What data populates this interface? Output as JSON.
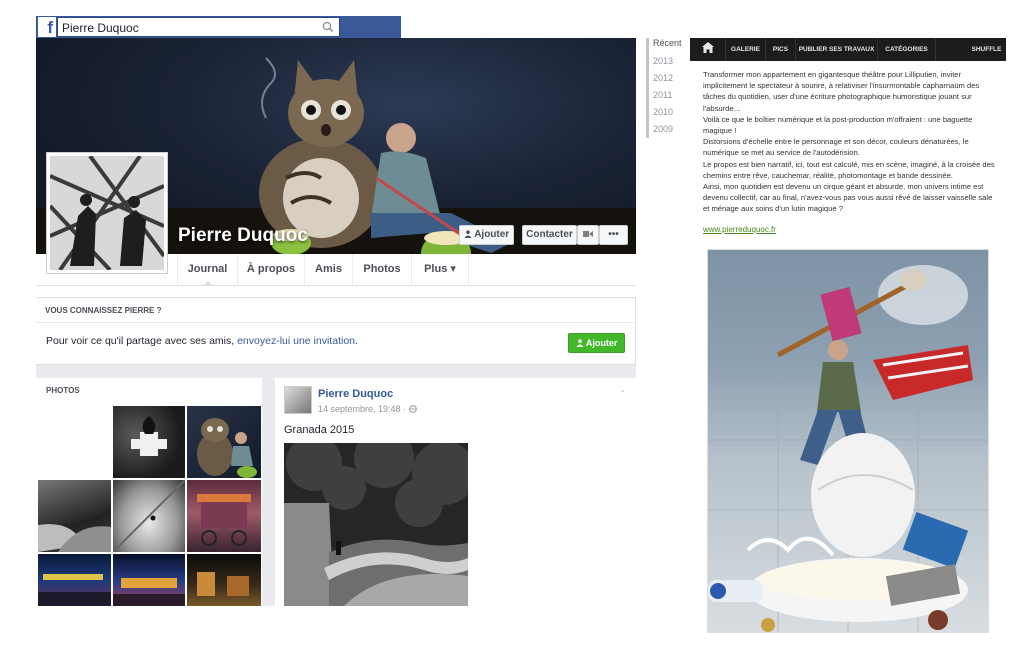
{
  "facebook": {
    "logo": "f",
    "search_value": "Pierre Duquoc",
    "profile_name": "Pierre Duquoc",
    "buttons": {
      "add": "Ajouter",
      "contact": "Contacter",
      "more": "•••"
    },
    "tabs": [
      "Journal",
      "À propos",
      "Amis",
      "Photos",
      "Plus ▾"
    ],
    "know": {
      "title": "VOUS CONNAISSEZ PIERRE ?",
      "text_before": "Pour voir ce qu'il partage avec ses amis, ",
      "link": "envoyez-lui une invitation.",
      "button": "Ajouter"
    },
    "photos_title": "PHOTOS",
    "post": {
      "author": "Pierre Duquoc",
      "date": "14 septembre, 19:48 · ",
      "text": "Granada 2015",
      "chevron": "⌄"
    },
    "timeline_years": [
      "Récent",
      "2013",
      "2012",
      "2011",
      "2010",
      "2009"
    ]
  },
  "site": {
    "nav": [
      "GALERIE",
      "PICS",
      "PUBLIER SES TRAVAUX",
      "CATÉGORIES",
      "SHUFFLE"
    ],
    "paragraphs": [
      "Transformer mon appartement en gigantesque théâtre pour Lilliputien, inviter implicitement le spectateur à sourire, à relativiser l'insurmontable capharnaüm des tâches du quotidien, user d'une écriture photographique humoristique jouant sur l'absurde…",
      "Voilà ce que le boîtier numérique et la post-production m'offraient : une baguette magique !",
      "Distorsions d'échelle entre le personnage et son décor, couleurs dénaturées, le numérique se met au service de l'autodérision.",
      "Le propos est bien narratif, ici, tout est calculé, mis en scène, imaginé, à la croisée des chemins entre rêve, cauchemar, réalité, photomontage et bande dessinée.",
      "Ainsi, mon quotidien est devenu un cirque géant et absurde, mon univers intime est devenu collectif, car au final, n'avez-vous pas vous aussi rêvé de laisser vaisselle sale et ménage aux soins d'un lutin magique ?"
    ],
    "link": "www.pierreduquoc.fr"
  },
  "colors": {
    "facebook_blue": "#3b5998",
    "link_blue": "#365899",
    "button_green": "#42b72a",
    "site_nav": "#1c1c1c",
    "site_link": "#4a8a1a"
  },
  "icons": [
    "search-icon",
    "person-add-icon",
    "video-icon",
    "home-icon",
    "globe-icon"
  ]
}
